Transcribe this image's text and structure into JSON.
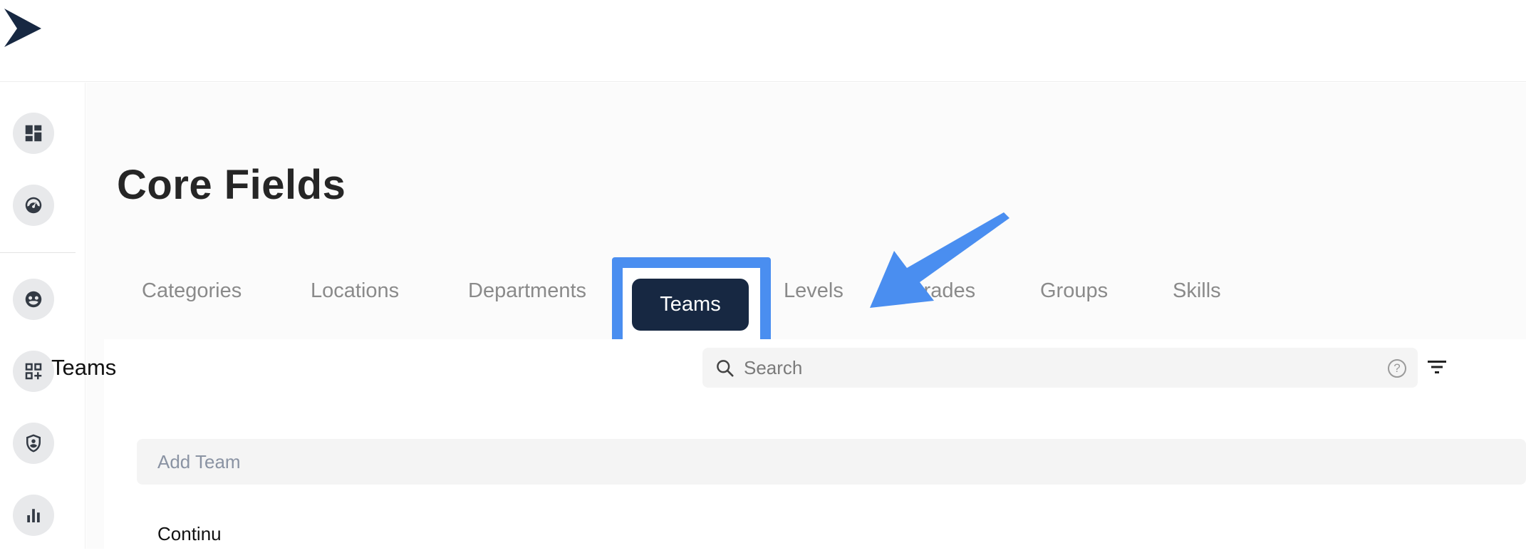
{
  "app": {
    "logo_icon": "play-arrow-logo-icon"
  },
  "sidebar": {
    "items": [
      {
        "name": "dashboard",
        "icon": "dashboard-icon"
      },
      {
        "name": "gauge",
        "icon": "speedometer-icon"
      },
      {
        "name": "people",
        "icon": "people-icon"
      },
      {
        "name": "add-widget",
        "icon": "apps-add-icon"
      },
      {
        "name": "security",
        "icon": "shield-person-icon"
      },
      {
        "name": "analytics",
        "icon": "bar-chart-icon"
      }
    ]
  },
  "page": {
    "title": "Core Fields"
  },
  "tabs": [
    {
      "label": "Categories",
      "active": false
    },
    {
      "label": "Locations",
      "active": false
    },
    {
      "label": "Departments",
      "active": false
    },
    {
      "label": "Teams",
      "active": true
    },
    {
      "label": "Levels",
      "active": false
    },
    {
      "label": "Grades",
      "active": false
    },
    {
      "label": "Groups",
      "active": false
    },
    {
      "label": "Skills",
      "active": false
    }
  ],
  "panel": {
    "title": "Teams",
    "search_placeholder": "Search",
    "help_glyph": "?",
    "add_placeholder": "Add Team",
    "rows": [
      "Continu"
    ]
  },
  "colors": {
    "highlight": "#4a8ef0",
    "active_tab_bg": "#172842",
    "arrow": "#4a8ef0"
  }
}
